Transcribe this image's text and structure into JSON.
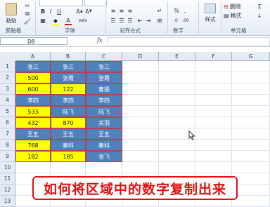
{
  "ribbon": {
    "paste_label": "粘贴",
    "bold": "B",
    "italic": "I",
    "underline": "U",
    "font_color_glyph": "A",
    "wen": "wén",
    "number_format": "%",
    "style_label": "样式",
    "delete_label": "删除",
    "format_label": "格式",
    "groups": {
      "clipboard": "剪贴板",
      "font": "字体",
      "alignment": "对齐方式",
      "number": "数字",
      "cells": "单元格"
    }
  },
  "formula_bar": {
    "name_box": "D8",
    "fx": "fx",
    "formula": ""
  },
  "sheet": {
    "columns": [
      "A",
      "B",
      "C",
      "D",
      "E",
      "F",
      "G"
    ],
    "rows": [
      "1",
      "2",
      "3",
      "4",
      "5",
      "6",
      "7",
      "8",
      "9",
      "10",
      "11",
      "12",
      "13"
    ],
    "data": [
      [
        {
          "v": "张三",
          "c": "blue"
        },
        {
          "v": "张三",
          "c": "blue"
        },
        {
          "v": "张三",
          "c": "blue"
        }
      ],
      [
        {
          "v": "500",
          "c": "yellow"
        },
        {
          "v": "张霞",
          "c": "blue"
        },
        {
          "v": "张霞",
          "c": "blue"
        }
      ],
      [
        {
          "v": "600",
          "c": "yellow"
        },
        {
          "v": "122",
          "c": "yellow"
        },
        {
          "v": "曹操",
          "c": "blue"
        }
      ],
      [
        {
          "v": "李四",
          "c": "blue"
        },
        {
          "v": "李四",
          "c": "blue"
        },
        {
          "v": "李四",
          "c": "blue"
        }
      ],
      [
        {
          "v": "533",
          "c": "yellow"
        },
        {
          "v": "陆飞",
          "c": "blue"
        },
        {
          "v": "陆飞",
          "c": "blue"
        }
      ],
      [
        {
          "v": "432",
          "c": "yellow"
        },
        {
          "v": "870",
          "c": "yellow"
        },
        {
          "v": "关羽",
          "c": "blue"
        }
      ],
      [
        {
          "v": "王五",
          "c": "blue"
        },
        {
          "v": "王五",
          "c": "blue"
        },
        {
          "v": "王五",
          "c": "blue"
        }
      ],
      [
        {
          "v": "768",
          "c": "yellow"
        },
        {
          "v": "秦科",
          "c": "blue"
        },
        {
          "v": "秦科",
          "c": "blue"
        }
      ],
      [
        {
          "v": "182",
          "c": "yellow"
        },
        {
          "v": "185",
          "c": "yellow"
        },
        {
          "v": "张飞",
          "c": "blue"
        }
      ]
    ]
  },
  "banner": {
    "text": "如何将区域中的数字复制出来"
  },
  "colors": {
    "yellow": "#ffff00",
    "blue": "#4f81bd",
    "banner_red": "#e01010"
  }
}
